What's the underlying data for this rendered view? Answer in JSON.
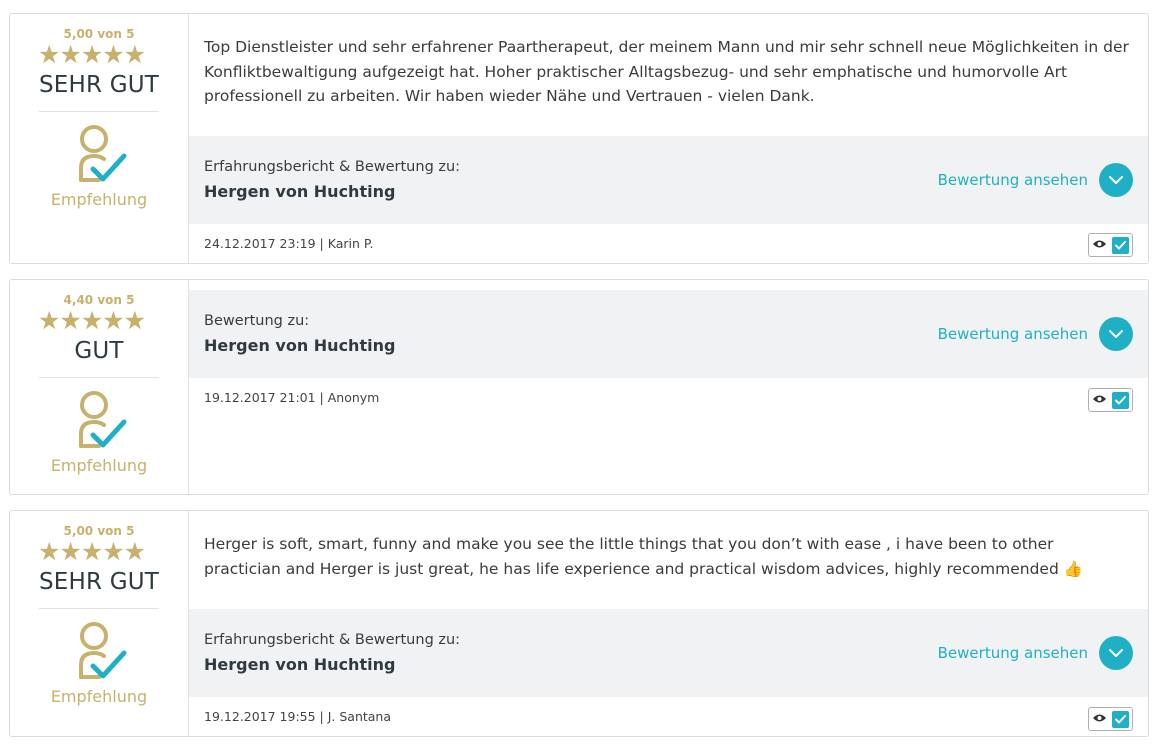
{
  "reviews": [
    {
      "score": "5,00 von 5",
      "stars_fraction": 1.0,
      "rating_word": "SEHR GUT",
      "recommendation": "Empfehlung",
      "text": "Top Dienstleister und sehr erfahrener Paartherapeut, der meinem Mann und mir sehr schnell neue Möglichkeiten in der Konfliktbewaltigung aufgezeigt hat. Hoher praktischer Alltagsbezug- und sehr emphatische und humorvolle Art professionell zu arbeiten. Wir haben wieder Nähe und Vertrauen - vielen Dank.",
      "subject_label": "Erfahrungsbericht & Bewertung zu:",
      "subject_name": "Hergen von Huchting",
      "view_label": "Bewertung ansehen",
      "meta": "24.12.2017 23:19 | Karin P."
    },
    {
      "score": "4,40 von 5",
      "stars_fraction": 0.88,
      "rating_word": "GUT",
      "recommendation": "Empfehlung",
      "subject_label": "Bewertung zu:",
      "subject_name": "Hergen von Huchting",
      "view_label": "Bewertung ansehen",
      "meta": "19.12.2017 21:01 | Anonym"
    },
    {
      "score": "5,00 von 5",
      "stars_fraction": 1.0,
      "rating_word": "SEHR GUT",
      "recommendation": "Empfehlung",
      "text": "Herger is soft, smart, funny and make you see the little things that you don’t with ease , i have been to other practician and Herger is just great, he has life experience and practical wisdom advices, highly recommended 👍",
      "subject_label": "Erfahrungsbericht & Bewertung zu:",
      "subject_name": "Hergen von Huchting",
      "view_label": "Bewertung ansehen",
      "meta": "19.12.2017 19:55 | J. Santana"
    }
  ],
  "colors": {
    "gold": "#c8b16c",
    "accent": "#1fb0c6",
    "grey_panel": "#f1f2f3"
  },
  "icons": {
    "recommendation": "user-check-icon",
    "view_toggle": "chevron-down-icon",
    "visible": "eye-icon",
    "verified": "checkbox-checked-icon"
  }
}
